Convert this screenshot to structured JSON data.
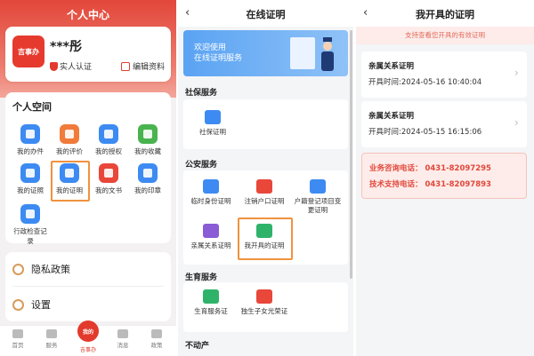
{
  "panel1": {
    "title": "个人中心",
    "logo_text": "吉事办",
    "user_name": "***彤",
    "verified_label": "实人认证",
    "edit_label": "编辑资料",
    "space_title": "个人空间",
    "grid": [
      {
        "label": "我的办件",
        "color": "#3d8bf2",
        "icon": "file-icon"
      },
      {
        "label": "我的评价",
        "color": "#f07b3a",
        "icon": "rate-icon"
      },
      {
        "label": "我的授权",
        "color": "#3d8bf2",
        "icon": "key-icon"
      },
      {
        "label": "我的收藏",
        "color": "#49b34f",
        "icon": "star-icon"
      },
      {
        "label": "我的证照",
        "color": "#3d8bf2",
        "icon": "id-card-icon"
      },
      {
        "label": "我的证明",
        "color": "#3d8bf2",
        "icon": "certificate-icon"
      },
      {
        "label": "我的文书",
        "color": "#e8473a",
        "icon": "document-icon"
      },
      {
        "label": "我的印章",
        "color": "#3d8bf2",
        "icon": "seal-icon"
      },
      {
        "label": "行政检查记录",
        "color": "#3d8bf2",
        "icon": "inspect-icon"
      }
    ],
    "menu": [
      {
        "label": "隐私政策",
        "icon": "privacy-icon"
      },
      {
        "label": "设置",
        "icon": "gear-icon"
      }
    ],
    "tabs": [
      {
        "label": "首页",
        "icon": "home-icon"
      },
      {
        "label": "服务",
        "icon": "service-icon"
      },
      {
        "label": "吉事办",
        "icon": "center-logo-icon"
      },
      {
        "label": "消息",
        "icon": "bell-icon"
      },
      {
        "label": "政策",
        "icon": "policy-icon"
      }
    ],
    "center_tab_badge": "我的",
    "accent": "#e23a2d"
  },
  "panel2": {
    "title": "在线证明",
    "banner_line1": "欢迎使用",
    "banner_line2": "在线证明服务",
    "sections": [
      {
        "label": "社保服务",
        "items": [
          {
            "label": "社保证明",
            "color": "#3d8bf2"
          }
        ]
      },
      {
        "label": "公安服务",
        "items": [
          {
            "label": "临时身份证明",
            "color": "#3d8bf2"
          },
          {
            "label": "注销户口证明",
            "color": "#e8473a"
          },
          {
            "label": "户籍登记项目变更证明",
            "color": "#3d8bf2"
          },
          {
            "label": "亲属关系证明",
            "color": "#8a5cd6"
          },
          {
            "label": "我开具的证明",
            "color": "#2fb36a"
          }
        ]
      },
      {
        "label": "生育服务",
        "items": [
          {
            "label": "生育服务证",
            "color": "#2fb36a"
          },
          {
            "label": "独生子女光荣证",
            "color": "#e8473a"
          }
        ]
      },
      {
        "label": "不动产",
        "items": []
      }
    ]
  },
  "panel3": {
    "title": "我开具的证明",
    "notice": "支持查看您开具的有效证明",
    "records": [
      {
        "title": "亲属关系证明",
        "time": "开具时间:2024-05-16 10:40:04"
      },
      {
        "title": "亲属关系证明",
        "time": "开具时间:2024-05-15 16:15:06"
      }
    ],
    "consult_phone": "业务咨询电话： 0431-82097295",
    "support_phone": "技术支持电话： 0431-82097893"
  }
}
